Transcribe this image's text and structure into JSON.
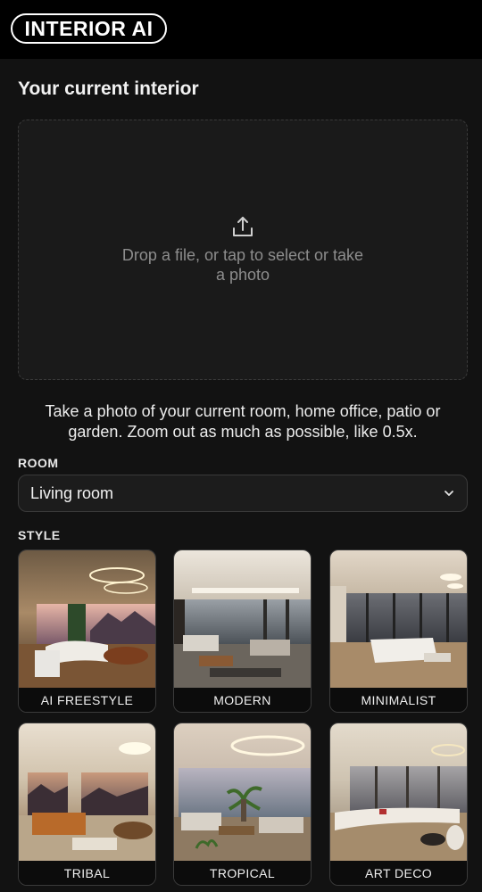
{
  "header": {
    "logo_text": "INTERIOR AI"
  },
  "upload": {
    "title": "Your current interior",
    "drop_text": "Drop a file, or tap to select or take a photo",
    "icon": "upload-icon",
    "hint": "Take a photo of your current room, home office, patio or garden. Zoom out as much as possible, like 0.5x."
  },
  "room": {
    "label": "ROOM",
    "selected": "Living room",
    "icon": "chevron-down-icon"
  },
  "style": {
    "label": "STYLE",
    "options": [
      {
        "label": "AI FREESTYLE"
      },
      {
        "label": "MODERN"
      },
      {
        "label": "MINIMALIST"
      },
      {
        "label": "TRIBAL"
      },
      {
        "label": "TROPICAL"
      },
      {
        "label": "ART DECO"
      }
    ]
  },
  "colors": {
    "background": "#121212",
    "topbar": "#000000",
    "accent": "#ffffff"
  }
}
